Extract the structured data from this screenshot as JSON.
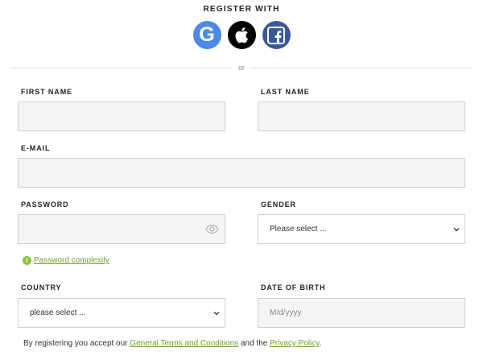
{
  "header": {
    "title": "REGISTER WITH"
  },
  "social": {
    "google_letter": "G",
    "buttons": [
      {
        "icon": "google-icon",
        "color": "#4a8ae8"
      },
      {
        "icon": "apple-icon",
        "color": "#000000"
      },
      {
        "icon": "facebook-icon",
        "color": "#3a5898"
      }
    ]
  },
  "divider": {
    "text": "or"
  },
  "form": {
    "first_name": {
      "label": "FIRST NAME",
      "value": "",
      "placeholder": ""
    },
    "last_name": {
      "label": "LAST NAME",
      "value": "",
      "placeholder": ""
    },
    "email": {
      "label": "E-MAIL",
      "value": "",
      "placeholder": ""
    },
    "password": {
      "label": "PASSWORD",
      "value": "",
      "placeholder": ""
    },
    "gender": {
      "label": "GENDER",
      "selected": "Please select ..."
    },
    "password_help": {
      "link": "Password complexity"
    },
    "country": {
      "label": "COUNTRY",
      "selected": "please select ..."
    },
    "dob": {
      "label": "DATE OF BIRTH",
      "placeholder": "M/d/yyyy",
      "value": ""
    }
  },
  "terms": {
    "before": "By registering you accept our ",
    "link1": "General Terms and Conditions",
    "middle": " and the ",
    "link2": "Privacy Policy",
    "after": "."
  },
  "colors": {
    "accent_green": "#6f9d23",
    "info_green": "#8dc33f"
  }
}
